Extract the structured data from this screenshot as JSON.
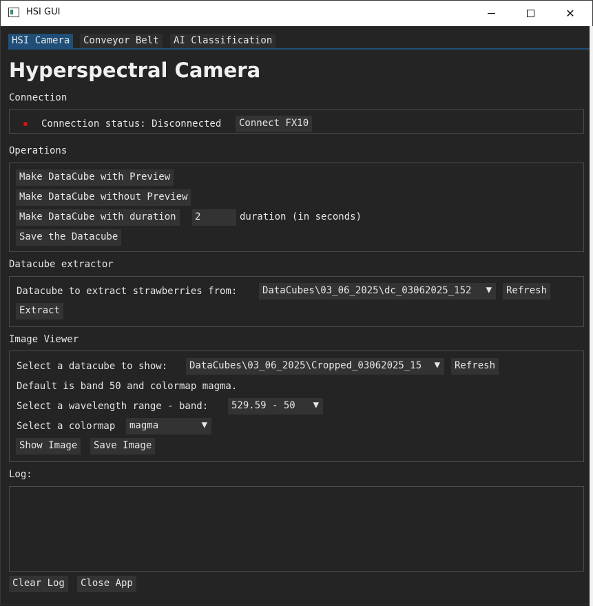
{
  "window": {
    "title": "HSI GUI"
  },
  "tabs": [
    "HSI Camera",
    "Conveyor Belt",
    "AI Classification"
  ],
  "page_heading": "Hyperspectral Camera",
  "connection": {
    "label": "Connection",
    "status_text": "Connection status: Disconnected",
    "status_color": "#e01010",
    "connect_button": "Connect FX10"
  },
  "operations": {
    "label": "Operations",
    "make_with_preview": "Make DataCube with Preview",
    "make_without_preview": "Make DataCube without Preview",
    "make_with_duration": "Make DataCube with duration",
    "duration_value": "2",
    "duration_label": "duration (in seconds)",
    "save_datacube": "Save the Datacube"
  },
  "extractor": {
    "label": "Datacube extractor",
    "prompt": "Datacube to extract strawberries from:",
    "selected": "DataCubes\\03_06_2025\\dc_03062025_152",
    "refresh": "Refresh",
    "extract": "Extract"
  },
  "viewer": {
    "label": "Image Viewer",
    "select_prompt": "Select a datacube to show:",
    "selected": "DataCubes\\03_06_2025\\Cropped_03062025_15",
    "refresh": "Refresh",
    "default_note": "Default is band 50 and colormap magma.",
    "wavelength_prompt": "Select a wavelength range - band:",
    "wavelength_selected": "529.59 - 50",
    "colormap_prompt": "Select a colormap",
    "colormap_selected": "magma",
    "show_image": "Show Image",
    "save_image": "Save Image"
  },
  "log": {
    "label": "Log:",
    "clear": "Clear Log",
    "close": "Close App"
  },
  "icons": {
    "dropdown": "▼"
  },
  "colors": {
    "accent": "#1f4f78",
    "background": "#242424",
    "button": "#333333"
  }
}
